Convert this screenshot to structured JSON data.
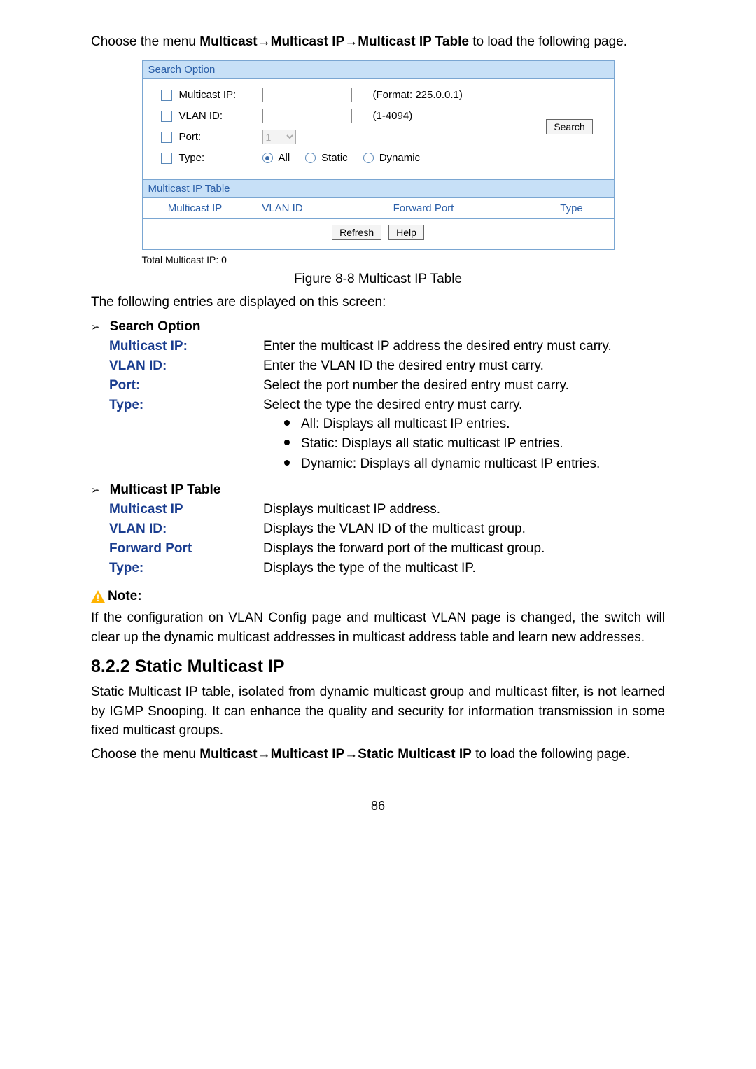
{
  "intro": {
    "prefix": "Choose the menu ",
    "path_b1": "Multicast",
    "arrow": "→",
    "path_b2": "Multicast IP",
    "path_b3": "Multicast IP Table",
    "suffix": " to load the following page."
  },
  "figure": {
    "header1": "Search Option",
    "multicast_ip_label": "Multicast IP:",
    "multicast_ip_fmt": "(Format: 225.0.0.1)",
    "vlan_label": "VLAN ID:",
    "vlan_fmt": "(1-4094)",
    "port_label": "Port:",
    "port_value": "1",
    "type_label": "Type:",
    "type_all": "All",
    "type_static": "Static",
    "type_dynamic": "Dynamic",
    "search_btn": "Search",
    "header2": "Multicast IP Table",
    "th_mip": "Multicast IP",
    "th_vlan": "VLAN ID",
    "th_fwd": "Forward Port",
    "th_type": "Type",
    "refresh_btn": "Refresh",
    "help_btn": "Help",
    "total": "Total Multicast IP: 0",
    "caption": "Figure 8-8 Multicast IP Table"
  },
  "entries_intro": "The following entries are displayed on this screen:",
  "so_heading": "Search Option",
  "so": {
    "mip_l": "Multicast IP:",
    "mip_d": "Enter the multicast IP address the desired entry must carry.",
    "vlan_l": "VLAN ID:",
    "vlan_d": "Enter the VLAN ID the desired entry must carry.",
    "port_l": "Port:",
    "port_d": "Select the port number the desired entry must carry.",
    "type_l": "Type:",
    "type_d": "Select the type the desired entry must carry.",
    "type_b1": "All: Displays all multicast IP entries.",
    "type_b2": "Static: Displays all static multicast IP entries.",
    "type_b3": "Dynamic: Displays all dynamic multicast IP entries."
  },
  "mt_heading": "Multicast IP Table",
  "mt": {
    "mip_l": "Multicast IP",
    "mip_d": "Displays multicast IP address.",
    "vlan_l": "VLAN ID:",
    "vlan_d": "Displays the VLAN ID of the multicast group.",
    "fwd_l": "Forward Port",
    "fwd_d": "Displays the forward port of the multicast group.",
    "type_l": "Type:",
    "type_d": "Displays the type of the multicast IP."
  },
  "note_label": "Note:",
  "note_text": "If the configuration on VLAN Config page and multicast VLAN page is changed, the switch will clear up the dynamic multicast addresses in multicast address table and learn new addresses.",
  "section_num": "8.2.2 ",
  "section_title": "Static Multicast IP",
  "static_para": "Static Multicast IP table, isolated from dynamic multicast group and multicast filter, is not learned by IGMP Snooping. It can enhance the quality and security for information transmission in some fixed multicast groups.",
  "intro2": {
    "prefix": "Choose the menu ",
    "path_b1": "Multicast",
    "path_b2": "Multicast IP",
    "path_b3": "Static Multicast IP",
    "suffix": " to load the following page."
  },
  "page_num": "86",
  "arrow_glyph": "➢"
}
